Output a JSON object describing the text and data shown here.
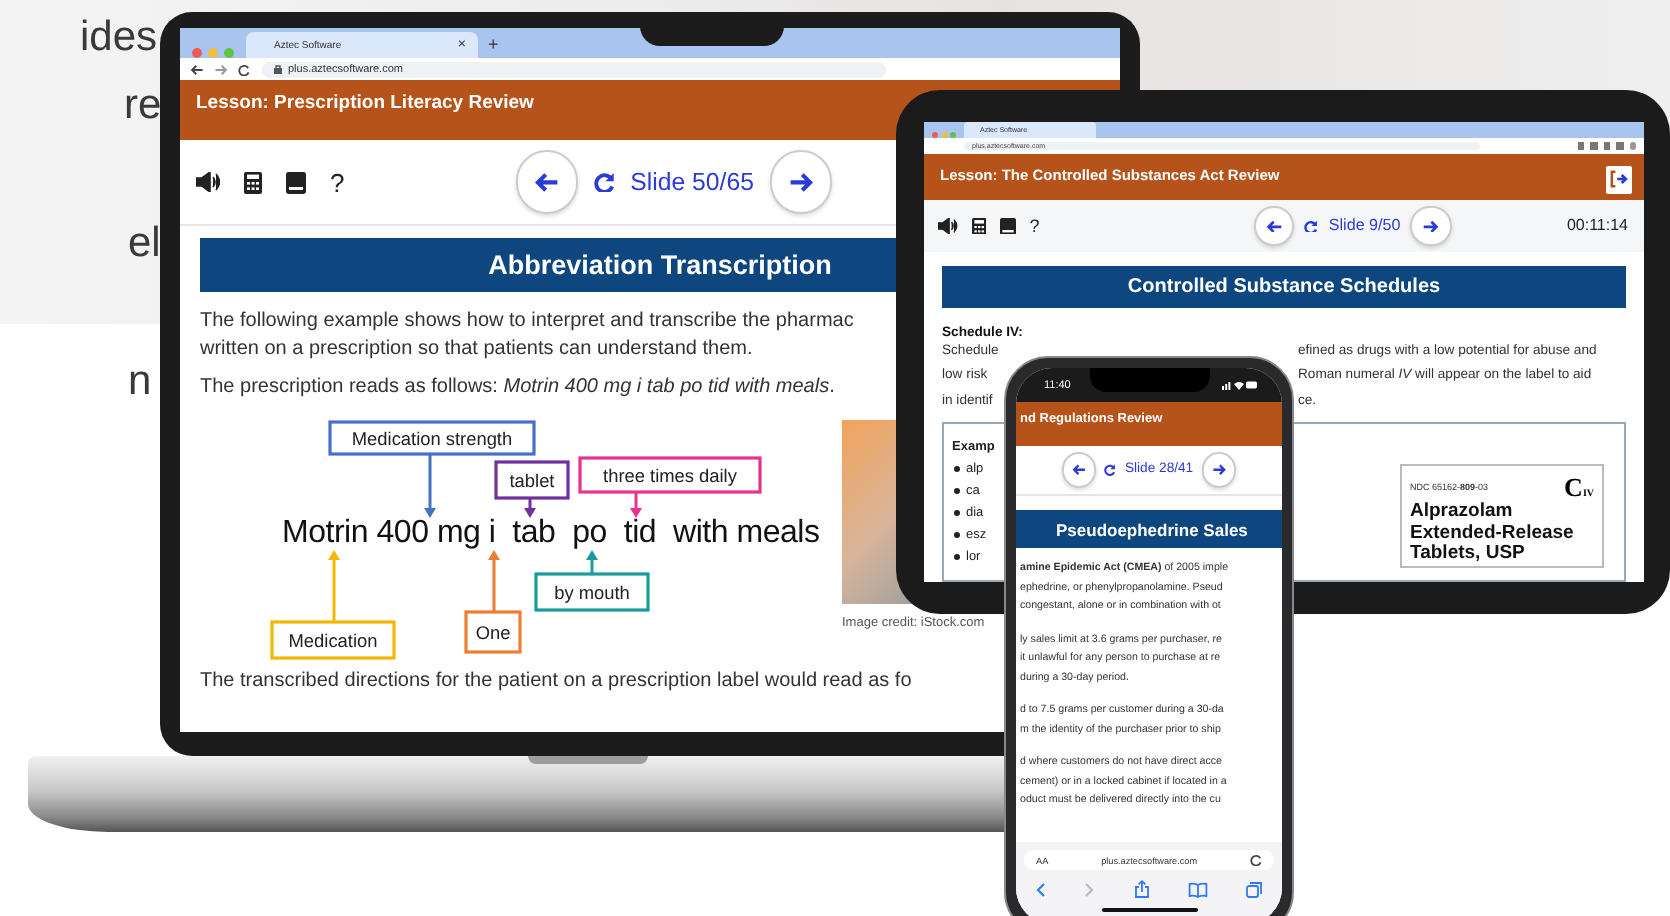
{
  "background": {
    "text_fragments": [
      "ides",
      "re",
      "el",
      "n"
    ]
  },
  "laptop": {
    "browser": {
      "tab_title": "Aztec Software",
      "tab_close": "×",
      "new_tab": "+",
      "url": "plus.aztecsoftware.com"
    },
    "lesson_title": "Lesson: Prescription Literacy Review",
    "help": "?",
    "slide": "Slide 50/65",
    "slide_title": "Abbreviation Transcription",
    "paragraph_lines": [
      "The following example shows how to interpret and transcribe the pharmac",
      "written on a prescription so that patients can understand them."
    ],
    "prescription": "The prescription reads as follows: *Motrin 400 mg i tab po tid with meals*.",
    "diagram": {
      "sentence": "Motrin 400 mg i  tab  po  tid  with meals",
      "labels": [
        {
          "text": "Medication strength",
          "color": "#4472c4"
        },
        {
          "text": "tablet",
          "color": "#7030a0"
        },
        {
          "text": "three times daily",
          "color": "#e6338f"
        },
        {
          "text": "by mouth",
          "color": "#1a9c9c"
        },
        {
          "text": "Medication",
          "color": "#f2b705"
        },
        {
          "text": "One",
          "color": "#ed7d31"
        }
      ]
    },
    "image_caption": "Image credit: iStock.com",
    "closing_line": "The transcribed directions for the patient on a prescription label would read as fo"
  },
  "tablet": {
    "browser": {
      "tab_title": "Aztec Software",
      "url": "plus.aztecsoftware.com"
    },
    "lesson_title": "Lesson: The Controlled Substances Act Review",
    "help": "?",
    "slide": "Slide 9/50",
    "timer": "00:11:14",
    "slide_title": "Controlled Substance Schedules",
    "schedule_heading": "Schedule IV:",
    "paragraph_lines": [
      {
        "left": "Schedule",
        "right": "efined as drugs with a low potential for abuse and"
      },
      {
        "left": "low risk",
        "right": "Roman numeral *IV* will appear on the label to aid"
      },
      {
        "left": "in identif",
        "right": "ce."
      }
    ],
    "examples_heading": "Examp",
    "example_items": [
      "alp",
      "ca",
      "dia",
      "esz",
      "lor"
    ],
    "drug_label": {
      "ndc": "NDC 65162-**809**-03",
      "schedule_symbol": "C",
      "schedule_numeral": "IV",
      "name": "Alprazolam Extended-Release Tablets, USP"
    }
  },
  "phone": {
    "time": "11:40",
    "lesson_title": "nd Regulations Review",
    "slide": "Slide 28/41",
    "slide_title": "Pseudoephedrine Sales",
    "paragraphs": [
      [
        "**amine Epidemic Act (CMEA)** of 2005 imple",
        "ephedrine, or phenylpropanolamine. Pseud",
        "congestant, alone or in combination with ot"
      ],
      [
        "ly sales limit at 3.6 grams per purchaser, re",
        "it unlawful for any person to purchase at re",
        "during a 30-day period."
      ],
      [
        "d to 7.5 grams per customer during a 30-da",
        "m the identity of the purchaser prior to ship"
      ],
      [
        "d where customers do not have direct acce",
        "cement) or in a locked cabinet if located in a",
        "oduct must be delivered directly into the cu"
      ]
    ],
    "text_size": "AA",
    "url": "plus.aztecsoftware.com"
  }
}
